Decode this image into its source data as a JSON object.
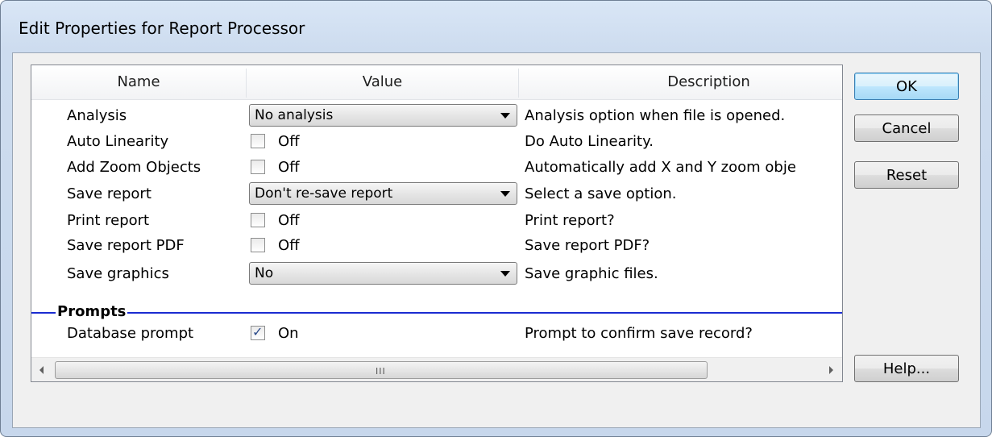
{
  "window": {
    "title": "Edit Properties for Report Processor"
  },
  "grid": {
    "columns": [
      "Name",
      "Value",
      "Description"
    ],
    "rows": [
      {
        "name": "Analysis",
        "type": "combo",
        "value": "No analysis",
        "description": "Analysis option when file is opened."
      },
      {
        "name": "Auto Linearity",
        "type": "checkbox",
        "checked": false,
        "value": "Off",
        "description": "Do Auto Linearity."
      },
      {
        "name": "Add Zoom Objects",
        "type": "checkbox",
        "checked": false,
        "value": "Off",
        "description": "Automatically add X and Y zoom obje"
      },
      {
        "name": "Save report",
        "type": "combo",
        "value": "Don't re-save report",
        "description": "Select a save option."
      },
      {
        "name": "Print report",
        "type": "checkbox",
        "checked": false,
        "value": "Off",
        "description": "Print report?"
      },
      {
        "name": "Save report PDF",
        "type": "checkbox",
        "checked": false,
        "value": "Off",
        "description": "Save report PDF?"
      },
      {
        "name": "Save graphics",
        "type": "combo",
        "value": "No",
        "description": "Save graphic files."
      }
    ],
    "section": {
      "label": "Prompts",
      "color": "#1a2bd1",
      "rows": [
        {
          "name": "Database prompt",
          "type": "checkbox",
          "checked": true,
          "value": "On",
          "description": "Prompt to confirm save record?"
        }
      ]
    },
    "scrollbar_grip": "III"
  },
  "buttons": {
    "ok": "OK",
    "cancel": "Cancel",
    "reset": "Reset",
    "help": "Help..."
  }
}
